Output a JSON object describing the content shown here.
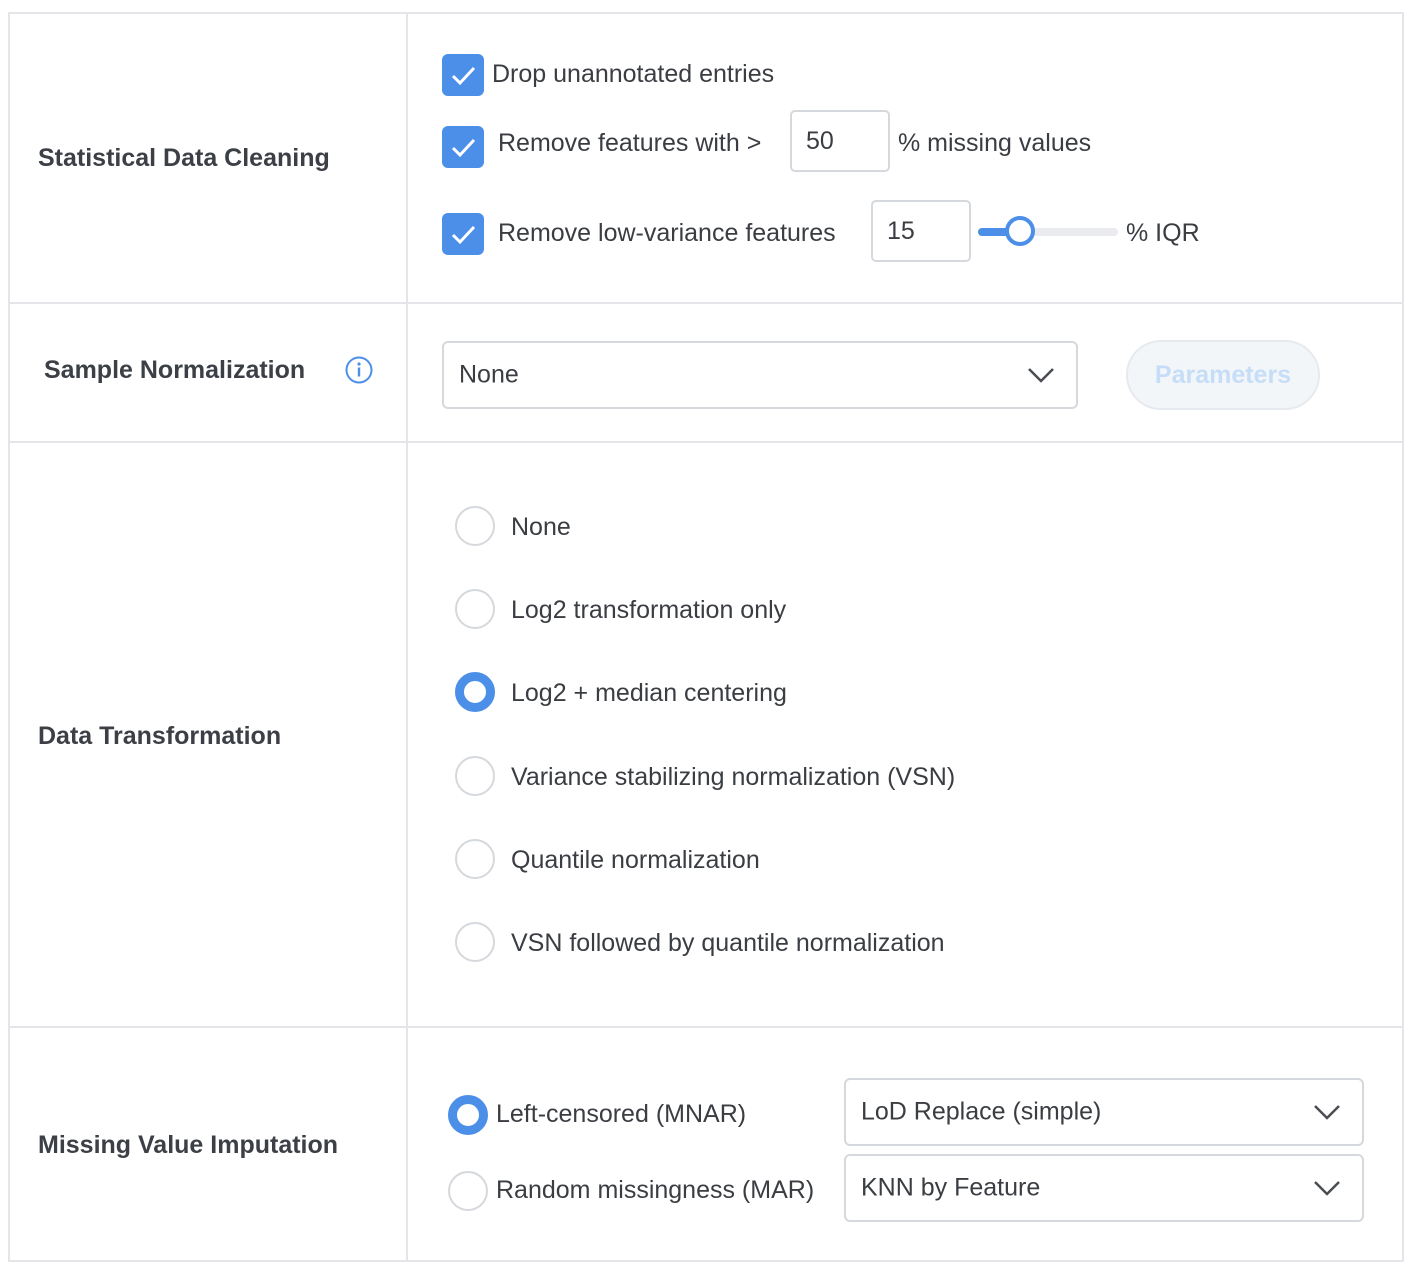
{
  "cleaning": {
    "label": "Statistical Data Cleaning",
    "drop_unannotated": {
      "label": "Drop unannotated entries",
      "checked": true
    },
    "remove_missing": {
      "label": "Remove features with >",
      "value": "50",
      "suffix": "% missing values",
      "checked": true
    },
    "remove_low_variance": {
      "label": "Remove low-variance features",
      "value": "15",
      "suffix": "% IQR",
      "checked": true,
      "slider_fraction": 0.3
    }
  },
  "normalization": {
    "label": "Sample Normalization",
    "info_icon": "info-icon",
    "selected": "None",
    "parameters_label": "Parameters"
  },
  "transformation": {
    "label": "Data Transformation",
    "options": [
      {
        "label": "None",
        "checked": false
      },
      {
        "label": "Log2 transformation only",
        "checked": false
      },
      {
        "label": "Log2 + median centering",
        "checked": true
      },
      {
        "label": "Variance stabilizing normalization (VSN)",
        "checked": false
      },
      {
        "label": "Quantile normalization",
        "checked": false
      },
      {
        "label": "VSN followed by quantile normalization",
        "checked": false
      }
    ]
  },
  "imputation": {
    "label": "Missing Value Imputation",
    "left_censored": {
      "label": "Left-censored (MNAR)",
      "checked": true,
      "method": "LoD Replace (simple)"
    },
    "random": {
      "label": "Random missingness (MAR)",
      "checked": false,
      "method": "KNN by Feature"
    }
  },
  "colors": {
    "accent": "#4c8fe8",
    "border": "#e3e5e8",
    "text": "#3a3d42",
    "disabled_text": "#c6ddf8"
  }
}
